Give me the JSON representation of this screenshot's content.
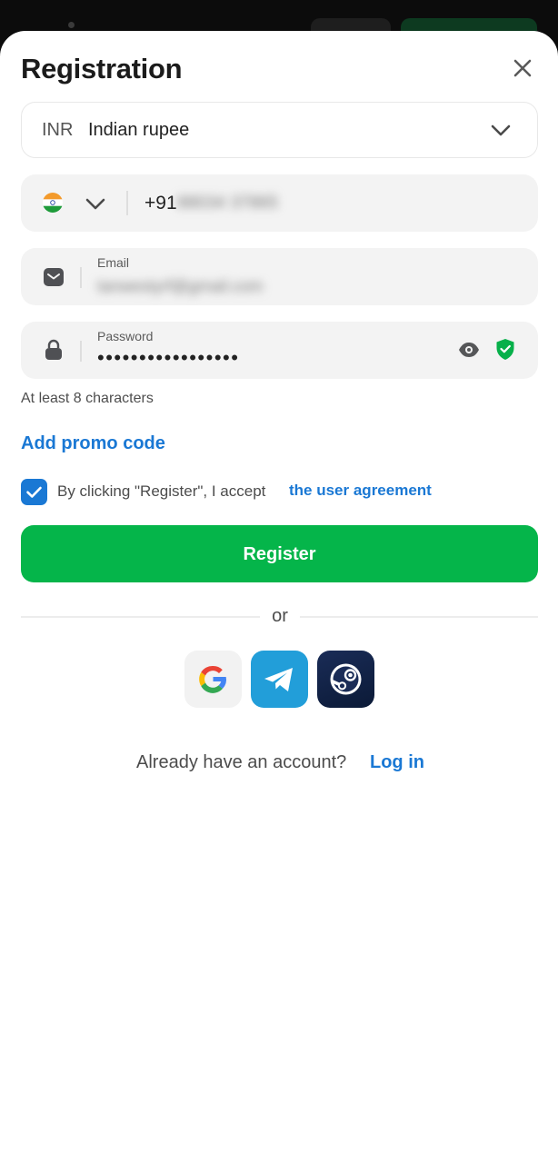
{
  "header": {
    "title": "Registration"
  },
  "currency": {
    "code": "INR",
    "name": "Indian rupee"
  },
  "phone": {
    "prefix": "+91",
    "number_blurred": "88034 37865"
  },
  "email": {
    "label": "Email",
    "value_blurred": "tanwestyrf@gmail.com"
  },
  "password": {
    "label": "Password",
    "value_masked": "•••••••••••••••••",
    "hint": "At least 8 characters"
  },
  "promo": {
    "label": "Add promo code"
  },
  "agreement": {
    "text": "By clicking \"Register\", I accept",
    "link": "the user agreement",
    "checked": true
  },
  "register": {
    "label": "Register"
  },
  "divider": {
    "label": "or"
  },
  "footer": {
    "question": "Already have an account?",
    "login_label": "Log in"
  },
  "colors": {
    "accent": "#1a78d4",
    "primary_button": "#05b54a",
    "field_bg": "#f3f3f3",
    "shield": "#07b04a"
  },
  "icons": [
    "close-icon",
    "chevron-down-icon",
    "india-flag-icon",
    "envelope-icon",
    "lock-icon",
    "eye-icon",
    "shield-check-icon",
    "checkmark-icon",
    "google-icon",
    "telegram-icon",
    "steam-icon"
  ]
}
